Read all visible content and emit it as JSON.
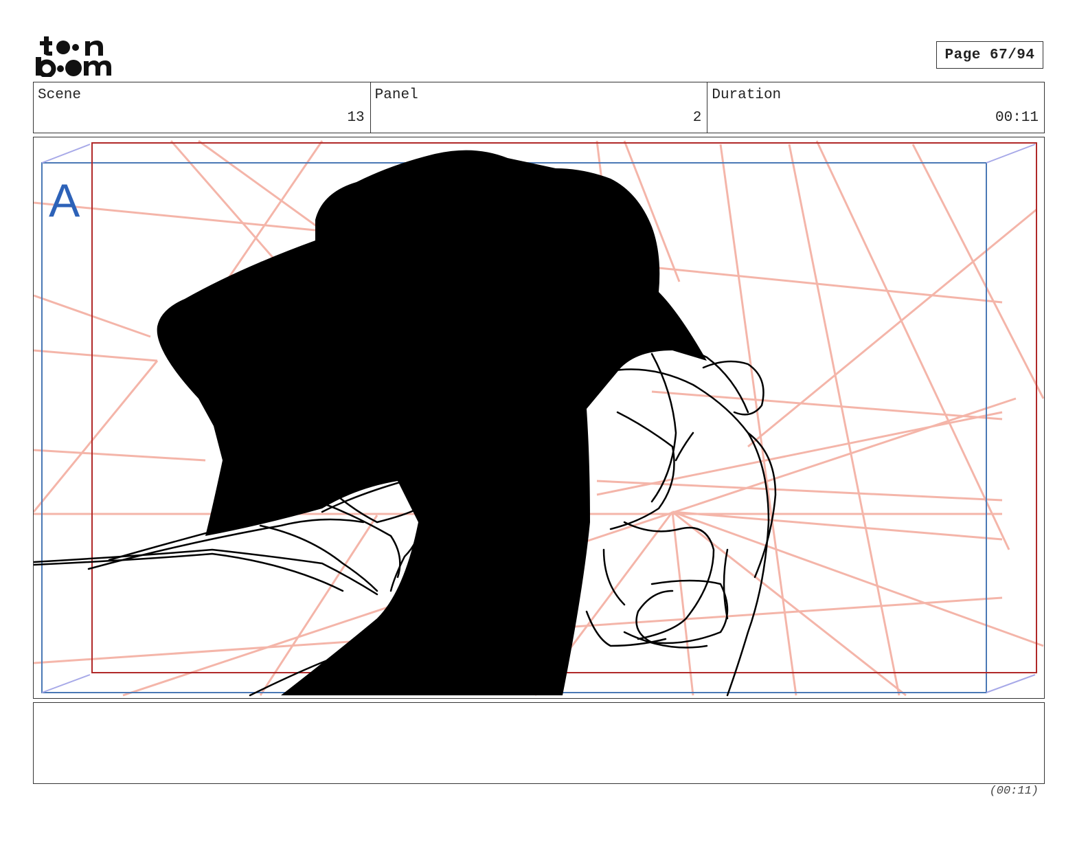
{
  "header": {
    "logo_text": "toon boom",
    "page_label": "Page 67/94"
  },
  "info": {
    "scene_label": "Scene",
    "scene_value": "13",
    "panel_label": "Panel",
    "panel_value": "2",
    "duration_label": "Duration",
    "duration_value": "00:11"
  },
  "panel_image": {
    "layer_letter": "A",
    "colors": {
      "camera_frame": "#b02828",
      "safe_frame": "#4a78b5",
      "perspective_lines": "#f3a99b",
      "ink": "#000000"
    }
  },
  "footer": {
    "duration_total": "(00:11)"
  }
}
